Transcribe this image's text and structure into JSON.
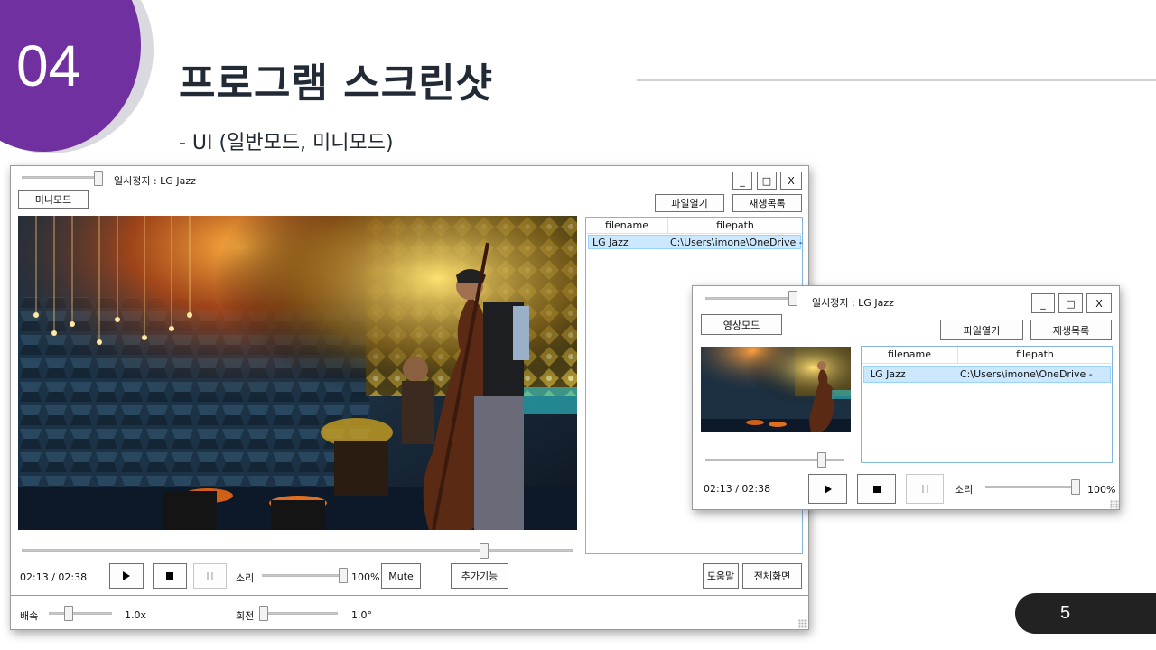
{
  "slide": {
    "number": "04",
    "title": "프로그램 스크린샷",
    "subtitle": "- UI (일반모드, 미니모드)",
    "page": "5"
  },
  "main_window": {
    "status": "일시정지 : LG Jazz",
    "mode_button": "미니모드",
    "win_min": "_",
    "win_max": "□",
    "win_close": "X",
    "open_file": "파일열기",
    "playlist": "재생목록",
    "list_headers": [
      "filename",
      "filepath"
    ],
    "rows": [
      {
        "filename": "LG Jazz",
        "filepath": "C:\\Users\\imone\\OneDrive -"
      }
    ],
    "time": "02:13 / 02:38",
    "volume_label": "소리",
    "volume_value": "100%",
    "mute": "Mute",
    "extra": "추가기능",
    "help": "도움말",
    "fullscreen": "전체화면",
    "speed_label": "배속",
    "speed_value": "1.0x",
    "rotate_label": "회전",
    "rotate_value": "1.0°",
    "seek_fraction": 0.84,
    "volume_fraction": 1.0
  },
  "mini_window": {
    "status": "일시정지 : LG Jazz",
    "mode_button": "영상모드",
    "win_min": "_",
    "win_max": "□",
    "win_close": "X",
    "open_file": "파일열기",
    "playlist": "재생목록",
    "list_headers": [
      "filename",
      "filepath"
    ],
    "rows": [
      {
        "filename": "LG Jazz",
        "filepath": "C:\\Users\\imone\\OneDrive -"
      }
    ],
    "time": "02:13 / 02:38",
    "volume_label": "소리",
    "volume_value": "100%",
    "seek_fraction": 0.84,
    "volume_fraction": 1.0
  },
  "icons": {
    "play": "play-icon",
    "stop": "stop-icon",
    "pause": "pause-icon"
  },
  "colors": {
    "accent": "#7030a0",
    "title": "#222a35",
    "selection": "#cce8ff"
  }
}
